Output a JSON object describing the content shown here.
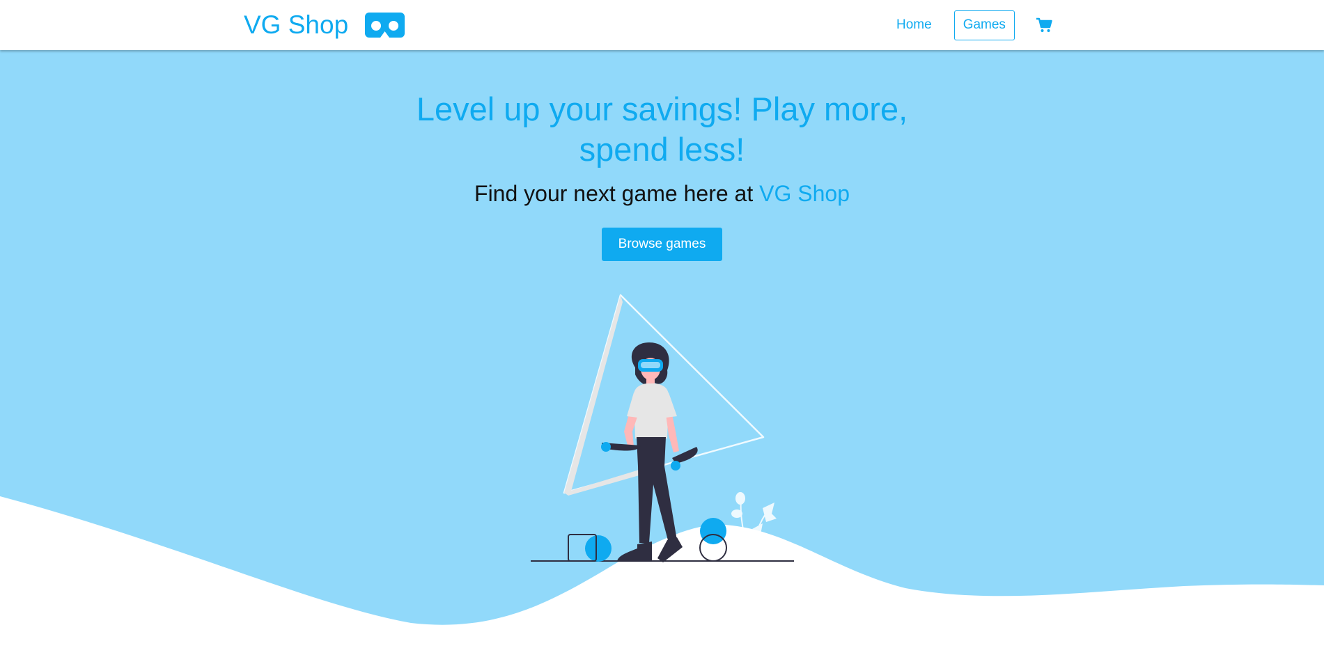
{
  "navbar": {
    "brand": "VG Shop",
    "brand_icon": "vr-headset-icon",
    "links": {
      "home": "Home",
      "games": "Games"
    },
    "cart_icon": "shopping-cart-icon"
  },
  "hero": {
    "headline": "Level up your savings! Play more, spend less!",
    "subline_prefix": "Find your next game here at ",
    "subline_accent": "VG Shop",
    "cta_label": "Browse games",
    "illustration": "woman-with-vr-headset-illustration"
  },
  "colors": {
    "accent": "#0faaf0",
    "hero_background": "#91d9fa",
    "nav_background": "#ffffff",
    "figure_dark": "#2f2e41"
  }
}
